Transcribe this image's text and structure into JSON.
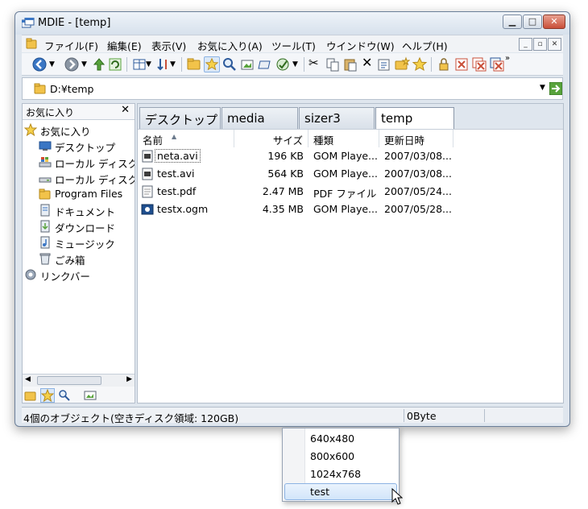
{
  "window": {
    "title": "MDIE - [temp]"
  },
  "menubar": {
    "items": [
      "ファイル(F)",
      "編集(E)",
      "表示(V)",
      "お気に入り(A)",
      "ツール(T)",
      "ウインドウ(W)",
      "ヘルプ(H)"
    ]
  },
  "address": {
    "value": "D:¥temp"
  },
  "sidebar": {
    "title": "お気に入り",
    "tree": [
      {
        "label": "お気に入り",
        "icon": "star-icon"
      },
      {
        "label": "デスクトップ",
        "icon": "desktop-icon"
      },
      {
        "label": "ローカル ディスク",
        "icon": "windows-drive-icon"
      },
      {
        "label": "ローカル ディスク",
        "icon": "drive-icon"
      },
      {
        "label": "Program Files",
        "icon": "folder-icon"
      },
      {
        "label": "ドキュメント",
        "icon": "documents-icon"
      },
      {
        "label": "ダウンロード",
        "icon": "downloads-icon"
      },
      {
        "label": "ミュージック",
        "icon": "music-icon"
      },
      {
        "label": "ごみ箱",
        "icon": "recycle-bin-icon"
      },
      {
        "label": "リンクバー",
        "icon": "gear-icon"
      }
    ]
  },
  "tabs": [
    "デスクトップ",
    "media",
    "sizer3",
    "temp"
  ],
  "list": {
    "columns": [
      "名前",
      "サイズ",
      "種類",
      "更新日時"
    ],
    "rows": [
      {
        "name": "neta.avi",
        "size": "196 KB",
        "type": "GOM Playe...",
        "date": "2007/03/08..."
      },
      {
        "name": "test.avi",
        "size": "564 KB",
        "type": "GOM Playe...",
        "date": "2007/03/08..."
      },
      {
        "name": "test.pdf",
        "size": "2.47 MB",
        "type": "PDF ファイル",
        "date": "2007/05/24..."
      },
      {
        "name": "testx.ogm",
        "size": "4.35 MB",
        "type": "GOM Playe...",
        "date": "2007/05/28..."
      }
    ]
  },
  "status": {
    "left": "4個のオブジェクト(空きディスク領域: 120GB)",
    "right": "0Byte"
  },
  "popup": {
    "items": [
      "640x480",
      "800x600",
      "1024x768",
      "test"
    ],
    "hovered": "test"
  },
  "colors": {
    "accent": "#3a76c4",
    "close_button": "#c94f39",
    "folder": "#f2c34a",
    "selection": "#d2e5fa"
  }
}
